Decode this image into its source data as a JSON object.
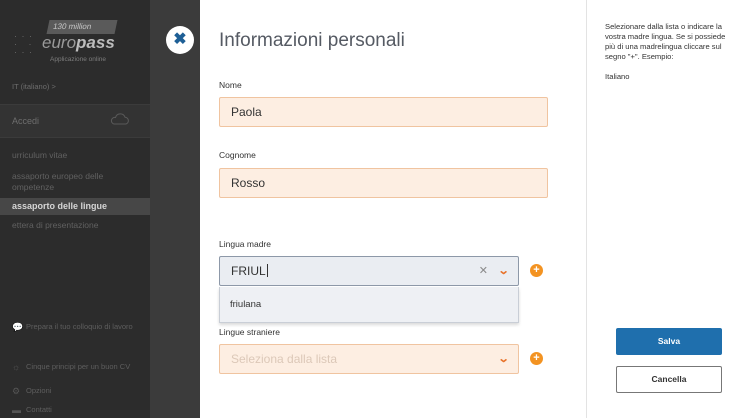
{
  "sidebar": {
    "logo": {
      "badge": "130 million",
      "brand_prefix": "euro",
      "brand_bold": "pass",
      "subtitle": "Applicazione online"
    },
    "language": "IT (italiano)  >",
    "login_label": "Accedi",
    "nav_items": [
      "urriculum vitae",
      "assaporto europeo delle ompetenze",
      "assaporto delle lingue",
      "ettera di presentazione"
    ],
    "tips": [
      "Prepara il tuo colloquio di lavoro",
      "Cinque principi per un buon CV",
      "Opzioni",
      "Contatti"
    ]
  },
  "modal": {
    "close_symbol": "✖",
    "title": "Informazioni personali",
    "name": {
      "label": "Nome",
      "value": "Paola"
    },
    "surname": {
      "label": "Cognome",
      "value": "Rosso"
    },
    "mother_tongue": {
      "label": "Lingua madre",
      "value": "FRIUL",
      "clear_symbol": "✕",
      "chevron_symbol": "⌄",
      "suggestion": "friulana"
    },
    "foreign_languages": {
      "label": "Lingue straniere",
      "placeholder": "Seleziona dalla lista",
      "chevron_symbol": "⌄"
    },
    "add_symbol": "+"
  },
  "help": {
    "text": "Selezionare dalla lista o indicare la vostra madre lingua. Se si possiede più di una madrelingua cliccare sul segno \"+\". Esempio:",
    "example": "Italiano",
    "save_label": "Salva",
    "cancel_label": "Cancella"
  },
  "colors": {
    "accent_blue": "#1f6fad",
    "field_bg": "#fdeee2",
    "field_border": "#f0c4a0",
    "add_orange": "#f39322"
  }
}
